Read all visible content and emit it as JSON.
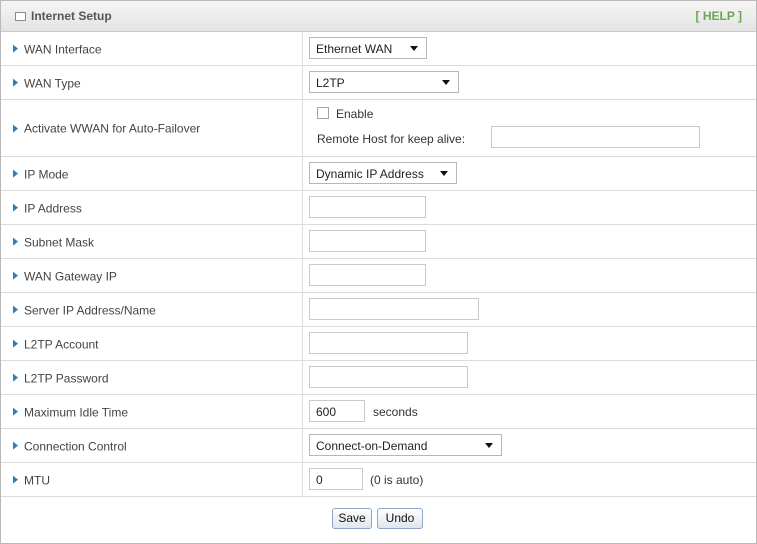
{
  "header": {
    "title": "Internet Setup",
    "help_label": "[ HELP ]"
  },
  "fields": {
    "wan_interface": {
      "label": "WAN Interface",
      "value": "Ethernet WAN"
    },
    "wan_type": {
      "label": "WAN Type",
      "value": "L2TP"
    },
    "auto_failover": {
      "label": "Activate WWAN for Auto-Failover",
      "enable_label": "Enable",
      "enabled": false,
      "remote_host_label": "Remote Host for keep alive:",
      "remote_host_value": ""
    },
    "ip_mode": {
      "label": "IP Mode",
      "value": "Dynamic IP Address"
    },
    "ip_address": {
      "label": "IP Address",
      "value": ""
    },
    "subnet_mask": {
      "label": "Subnet Mask",
      "value": ""
    },
    "wan_gateway": {
      "label": "WAN Gateway IP",
      "value": ""
    },
    "server_ip": {
      "label": "Server IP Address/Name",
      "value": ""
    },
    "l2tp_account": {
      "label": "L2TP Account",
      "value": ""
    },
    "l2tp_password": {
      "label": "L2TP Password",
      "value": ""
    },
    "max_idle": {
      "label": "Maximum Idle Time",
      "value": "600",
      "unit": "seconds"
    },
    "connection_control": {
      "label": "Connection Control",
      "value": "Connect-on-Demand"
    },
    "mtu": {
      "label": "MTU",
      "value": "0",
      "unit": "(0 is auto)"
    }
  },
  "actions": {
    "save_label": "Save",
    "undo_label": "Undo"
  },
  "colors": {
    "label_arrow": "#2b7fbf",
    "help_link": "#6aa84f",
    "border": "#dcdcdc"
  }
}
